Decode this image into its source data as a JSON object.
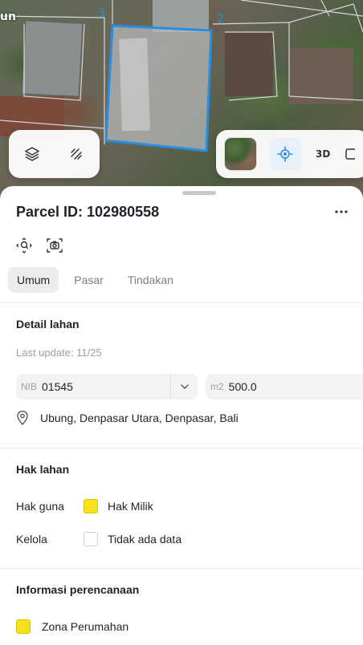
{
  "map": {
    "road_label": "un",
    "vertex_labels": [
      "3",
      "2"
    ],
    "colors": {
      "parcel_outline": "#2a8ee0"
    },
    "controls_left": [
      {
        "name": "layers-icon"
      },
      {
        "name": "measure-icon"
      }
    ],
    "controls_right": {
      "basemap": "satellite-thumbnail",
      "locate": "crosshair-icon",
      "three_d_label": "3D"
    }
  },
  "sheet": {
    "title": "Parcel ID: 102980558",
    "more_label": "•••",
    "tabs": [
      {
        "label": "Umum",
        "active": true
      },
      {
        "label": "Pasar",
        "active": false
      },
      {
        "label": "Tindakan",
        "active": false
      }
    ],
    "detail": {
      "heading": "Detail lahan",
      "last_update": "Last update: 11/25",
      "nib_prefix": "NIB",
      "nib_value": "01545",
      "area_prefix": "m2",
      "area_value": "500.0",
      "location": "Ubung, Denpasar Utara, Denpasar, Bali"
    },
    "rights": {
      "heading": "Hak lahan",
      "rows": [
        {
          "label": "Hak guna",
          "value": "Hak Milik",
          "color": "#f5e11d"
        },
        {
          "label": "Kelola",
          "value": "Tidak ada data",
          "color": "#ffffff"
        }
      ]
    },
    "planning": {
      "heading": "Informasi perencanaan",
      "zone": "Zona Perumahan",
      "zone_color": "#f5e11d"
    }
  }
}
